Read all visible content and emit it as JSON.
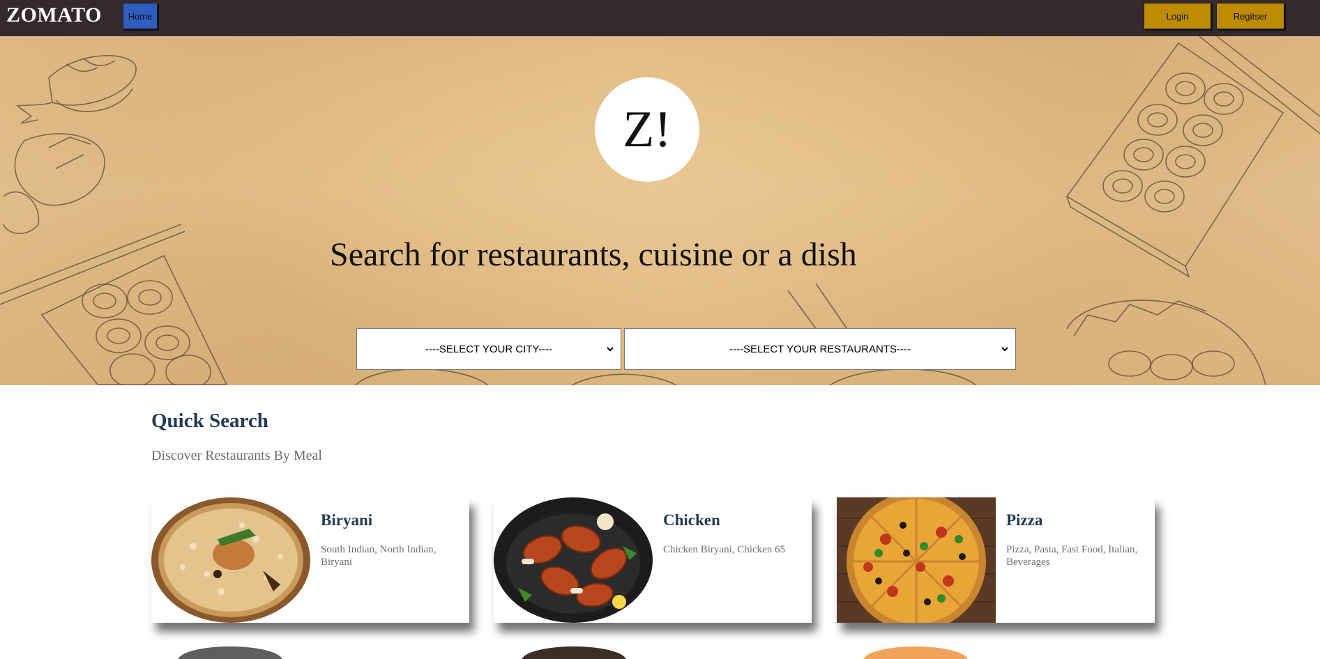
{
  "navbar": {
    "brand": "ZOMATO",
    "home_label": "Home",
    "login_label": "Login",
    "register_label": "Regitser"
  },
  "hero": {
    "logo_text": "Z!",
    "title": "Search for restaurants, cuisine or a dish",
    "city_select": {
      "selected": "----SELECT YOUR CITY----"
    },
    "restaurant_select": {
      "selected": "----SELECT YOUR RESTAURANTS----"
    }
  },
  "quick_search": {
    "title": "Quick Search",
    "subtitle": "Discover Restaurants By Meal",
    "cards": [
      {
        "name": "Biryani",
        "description": "South Indian, North Indian, Biryani",
        "icon": "biryani-image"
      },
      {
        "name": "Chicken",
        "description": "Chicken Biryani, Chicken 65",
        "icon": "chicken-image"
      },
      {
        "name": "Pizza",
        "description": "Pizza, Pasta, Fast Food, Italian, Beverages",
        "icon": "pizza-image"
      }
    ]
  },
  "colors": {
    "navbar_bg": "#342a2c",
    "home_button": "#2f5ec0",
    "auth_buttons": "#bf8b00",
    "heading_blue": "#1f3a55"
  }
}
